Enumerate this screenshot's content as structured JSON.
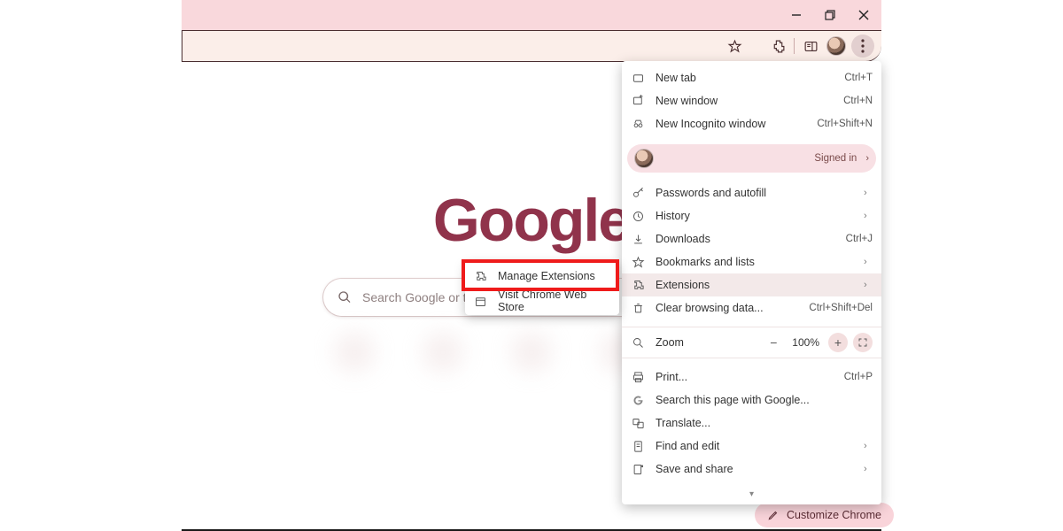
{
  "window": {
    "minimize": "–",
    "restore": "▢",
    "close": "✕"
  },
  "ntp": {
    "logo": "Google",
    "search_placeholder": "Search Google or type a URL"
  },
  "submenu": {
    "manage_extensions": "Manage Extensions",
    "visit_web_store": "Visit Chrome Web Store"
  },
  "menu": {
    "new_tab": {
      "label": "New tab",
      "shortcut": "Ctrl+T"
    },
    "new_window": {
      "label": "New window",
      "shortcut": "Ctrl+N"
    },
    "new_incognito": {
      "label": "New Incognito window",
      "shortcut": "Ctrl+Shift+N"
    },
    "signed_in": "Signed in",
    "passwords": "Passwords and autofill",
    "history": "History",
    "downloads": {
      "label": "Downloads",
      "shortcut": "Ctrl+J"
    },
    "bookmarks": "Bookmarks and lists",
    "extensions": "Extensions",
    "clear_data": {
      "label": "Clear browsing data...",
      "shortcut": "Ctrl+Shift+Del"
    },
    "zoom_label": "Zoom",
    "zoom_value": "100%",
    "print": {
      "label": "Print...",
      "shortcut": "Ctrl+P"
    },
    "search_page": "Search this page with Google...",
    "translate": "Translate...",
    "find_edit": "Find and edit",
    "save_share": "Save and share"
  },
  "customize": "Customize Chrome"
}
